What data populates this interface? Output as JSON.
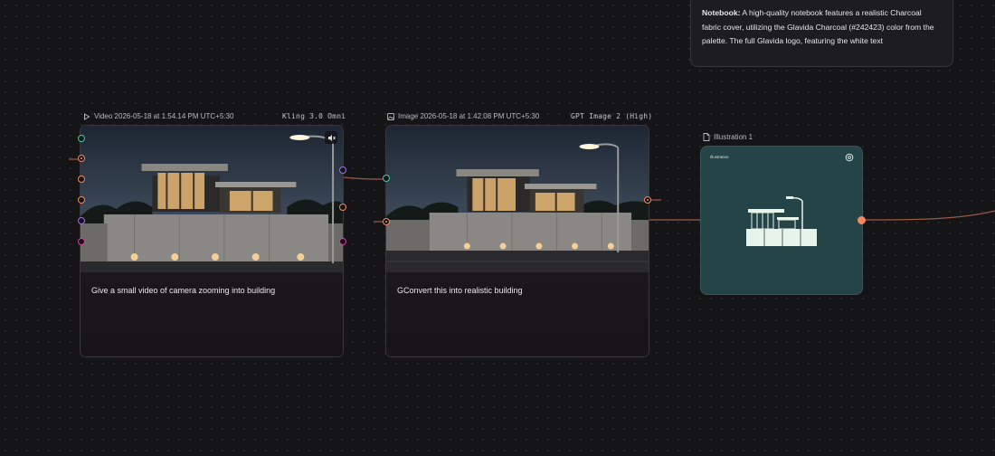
{
  "note": {
    "label": "Notebook:",
    "text": " A high-quality notebook features a realistic Charcoal fabric cover, utilizing the Glavida Charcoal (#242423) color from the palette. The full Glavida logo, featuring the white text"
  },
  "nodes": [
    {
      "type_icon": "play-icon",
      "title": "Video 2026-05-18 at 1.54.14 PM UTC+5:30",
      "model": "Kling 3.0 Omni",
      "prompt": "Give a small video of camera zooming into building"
    },
    {
      "type_icon": "image-icon",
      "title": "Image 2026-05-18 at 1.42.08 PM UTC+5:30",
      "model": "GPT Image 2 (High)",
      "prompt": "GConvert this into realistic building"
    }
  ],
  "illustration": {
    "type_icon": "document-icon",
    "title": "Illustration 1",
    "inner_label": "Illustration"
  },
  "colors": {
    "canvas": "#151518",
    "port_teal": "#3ecf9f",
    "port_orange": "#f08a5d",
    "port_purple": "#a56ee6",
    "port_magenta": "#d63fa8",
    "wire": "#b4644a",
    "illustration_bg": "#254447"
  }
}
